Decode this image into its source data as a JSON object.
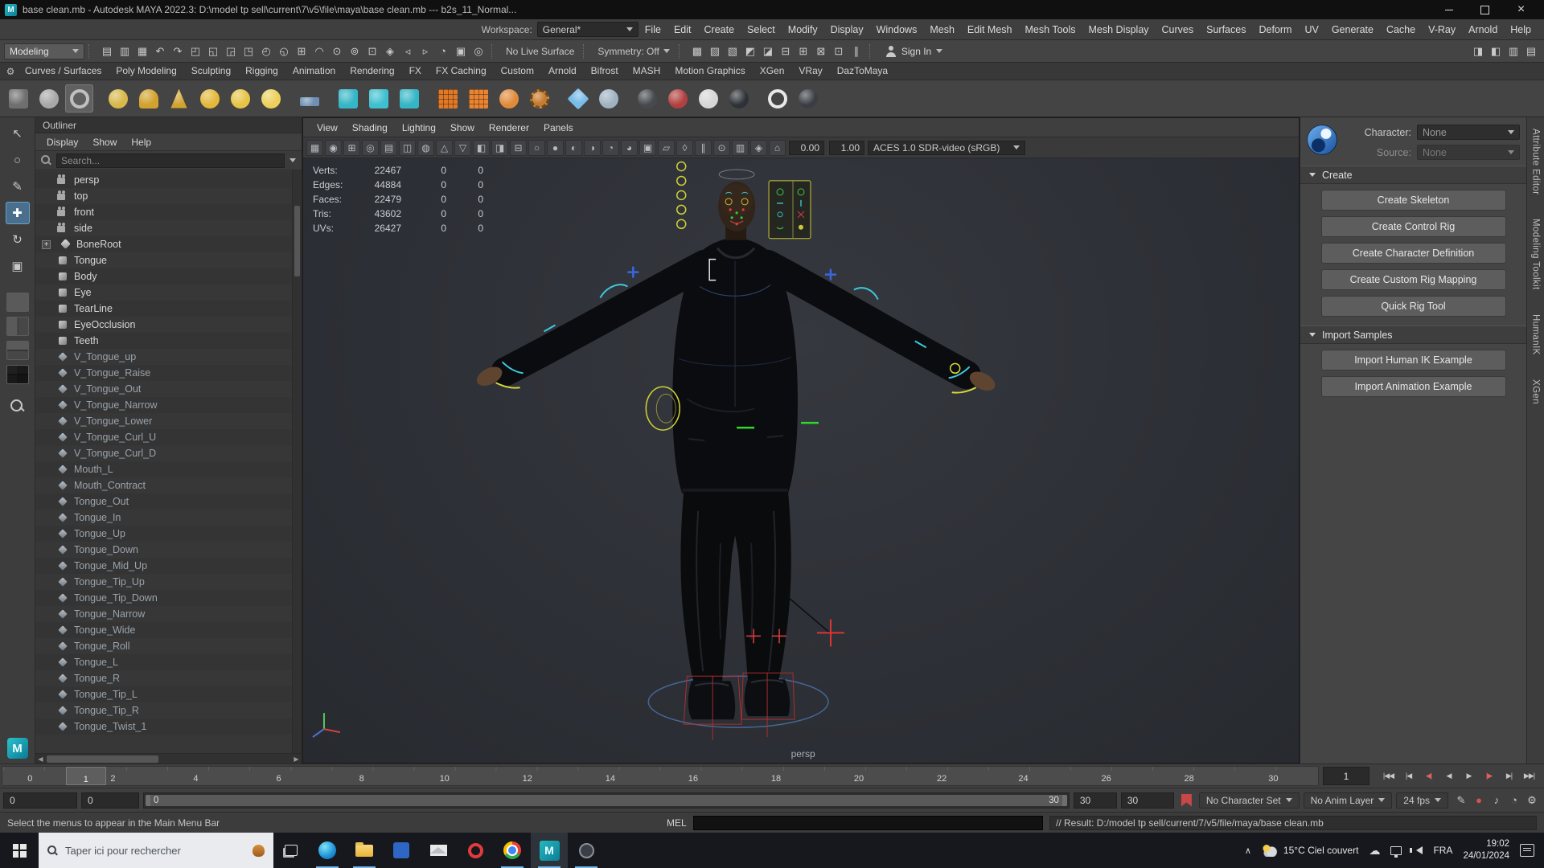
{
  "window": {
    "title": "base clean.mb - Autodesk MAYA 2022.3: D:\\model tp sell\\current\\7\\v5\\file\\maya\\base clean.mb  ---  b2s_11_Normal..."
  },
  "menu_bar": {
    "items": [
      "File",
      "Edit",
      "Create",
      "Select",
      "Modify",
      "Display",
      "Windows",
      "Mesh",
      "Edit Mesh",
      "Mesh Tools",
      "Mesh Display",
      "Curves",
      "Surfaces",
      "Deform",
      "UV",
      "Generate",
      "Cache",
      "V-Ray",
      "Arnold",
      "Help"
    ],
    "workspace_label": "Workspace:",
    "workspace_value": "General*"
  },
  "status_line": {
    "mode": "Modeling",
    "left_icons": [
      {
        "name": "new-scene-icon",
        "g": "▤"
      },
      {
        "name": "open-scene-icon",
        "g": "▥"
      },
      {
        "name": "save-scene-icon",
        "g": "▦"
      },
      {
        "name": "undo-icon",
        "g": "↶"
      },
      {
        "name": "redo-icon",
        "g": "↷"
      },
      {
        "name": "select-hierarchy-icon",
        "g": "◰"
      },
      {
        "name": "select-object-icon",
        "g": "◱"
      },
      {
        "name": "select-component-icon",
        "g": "◲"
      },
      {
        "name": "select-mask-vertex-icon",
        "g": "◳"
      },
      {
        "name": "select-mask-edge-icon",
        "g": "◴"
      },
      {
        "name": "select-mask-face-icon",
        "g": "◵"
      },
      {
        "name": "snap-to-grid-icon",
        "g": "⊞"
      },
      {
        "name": "snap-to-curve-icon",
        "g": "◠"
      },
      {
        "name": "snap-to-point-icon",
        "g": "⊙"
      },
      {
        "name": "snap-to-projected-center-icon",
        "g": "⊚"
      },
      {
        "name": "snap-to-view-plane-icon",
        "g": "⊡"
      },
      {
        "name": "make-live-icon",
        "g": "◈"
      },
      {
        "name": "input-connections-icon",
        "g": "◃"
      },
      {
        "name": "output-connections-icon",
        "g": "▹"
      },
      {
        "name": "construction-history-icon",
        "g": "◔"
      },
      {
        "name": "viewport-renderer-icon",
        "g": "▣"
      },
      {
        "name": "highlight-selection-icon",
        "g": "◎"
      }
    ],
    "no_live_surface": "No Live Surface",
    "symmetry": "Symmetry: Off",
    "right_icons": [
      {
        "name": "render-view-icon",
        "g": "▩"
      },
      {
        "name": "ipr-render-icon",
        "g": "▨"
      },
      {
        "name": "render-settings-icon",
        "g": "▧"
      },
      {
        "name": "hypershade-icon",
        "g": "◩"
      },
      {
        "name": "light-editor-icon",
        "g": "◪"
      },
      {
        "name": "toolkit-mesh-icon",
        "g": "⊟"
      },
      {
        "name": "toolkit-surface-icon",
        "g": "⊞"
      },
      {
        "name": "toolkit-uv-icon",
        "g": "⊠"
      },
      {
        "name": "toolkit-xgen-icon",
        "g": "⊡"
      },
      {
        "name": "pause-playback-icon",
        "g": "∥"
      }
    ],
    "sign_in": "Sign In",
    "panel_toggles": [
      {
        "name": "toggle-attribute-editor-icon",
        "g": "◨"
      },
      {
        "name": "toggle-tool-settings-icon",
        "g": "◧"
      },
      {
        "name": "toggle-channel-box-icon",
        "g": "▥"
      },
      {
        "name": "toggle-outliner-icon",
        "g": "▤"
      }
    ]
  },
  "shelf": {
    "tabs": [
      "Curves / Surfaces",
      "Poly Modeling",
      "Sculpting",
      "Rigging",
      "Animation",
      "Rendering",
      "FX",
      "FX Caching",
      "Custom",
      "Arnold",
      "Bifrost",
      "MASH",
      "Motion Graphics",
      "XGen",
      "VRay",
      "DazToMaya"
    ],
    "tools": [
      {
        "name": "shelf-tool-icon",
        "c": "#6f6f6f",
        "s": "shp-cube",
        "cls": ""
      },
      {
        "name": "shelf-tool-icon",
        "c": "#a8a8a8",
        "s": "shp-sphere",
        "cls": ""
      },
      {
        "name": "shelf-tool-icon",
        "c": "#c0c0c0",
        "s": "shp-ring",
        "cls": "active"
      },
      {
        "name": "shelf-tool-icon",
        "c": "#d8b84a",
        "s": "shp-sphere",
        "cls": "gap"
      },
      {
        "name": "shelf-tool-icon",
        "c": "#d2a22e",
        "s": "shp-dome",
        "cls": ""
      },
      {
        "name": "shelf-tool-icon",
        "c": "#d2a22e",
        "s": "shp-cone",
        "cls": ""
      },
      {
        "name": "shelf-tool-icon",
        "c": "#e2b83a",
        "s": "shp-sphere",
        "cls": ""
      },
      {
        "name": "shelf-tool-icon",
        "c": "#e6c446",
        "s": "shp-sphere",
        "cls": ""
      },
      {
        "name": "shelf-tool-icon",
        "c": "#ecd05a",
        "s": "shp-sphere",
        "cls": ""
      },
      {
        "name": "shelf-tool-icon",
        "c": "#6f90b2",
        "s": "shp-plane",
        "cls": "gap"
      },
      {
        "name": "shelf-tool-icon",
        "c": "#35b6c6",
        "s": "shp-cube",
        "cls": "gap"
      },
      {
        "name": "shelf-tool-icon",
        "c": "#3fc0d0",
        "s": "shp-cube",
        "cls": ""
      },
      {
        "name": "shelf-tool-icon",
        "c": "#35b6c6",
        "s": "shp-cube",
        "cls": ""
      },
      {
        "name": "shelf-tool-icon",
        "c": "#e07a28",
        "s": "shp-grid",
        "cls": "gap"
      },
      {
        "name": "shelf-tool-icon",
        "c": "#e88432",
        "s": "shp-grid",
        "cls": ""
      },
      {
        "name": "shelf-tool-icon",
        "c": "#e08a3a",
        "s": "shp-sphere",
        "cls": ""
      },
      {
        "name": "shelf-tool-icon",
        "c": "#c67c2e",
        "s": "shp-gear",
        "cls": ""
      },
      {
        "name": "shelf-tool-icon",
        "c": "#79bce8",
        "s": "shp-diamond",
        "cls": "gap"
      },
      {
        "name": "shelf-tool-icon",
        "c": "#9fb2c2",
        "s": "shp-sphere",
        "cls": ""
      },
      {
        "name": "shelf-tool-icon",
        "c": "#46494e",
        "s": "shp-sphere",
        "cls": "gap"
      },
      {
        "name": "shelf-tool-icon",
        "c": "#b24040",
        "s": "shp-sphere",
        "cls": ""
      },
      {
        "name": "shelf-tool-icon",
        "c": "#d6d6d6",
        "s": "shp-sphere",
        "cls": ""
      },
      {
        "name": "shelf-tool-icon",
        "c": "#2e3238",
        "s": "shp-sphere",
        "cls": ""
      },
      {
        "name": "shelf-tool-icon",
        "c": "#e8e8e8",
        "s": "shp-ring",
        "cls": "gap"
      },
      {
        "name": "shelf-tool-icon",
        "c": "#3a3e44",
        "s": "shp-sphere",
        "cls": ""
      }
    ]
  },
  "tool_column": {
    "tools": [
      {
        "name": "select-tool-icon",
        "g": "↖",
        "cls": ""
      },
      {
        "name": "lasso-tool-icon",
        "g": "○",
        "cls": ""
      },
      {
        "name": "paint-select-tool-icon",
        "g": "✎",
        "cls": ""
      },
      {
        "name": "move-tool-icon",
        "g": "✚",
        "cls": "active"
      },
      {
        "name": "rotate-tool-icon",
        "g": "↻",
        "cls": ""
      },
      {
        "name": "scale-tool-icon",
        "g": "▣",
        "cls": ""
      }
    ],
    "layouts": [
      {
        "name": "layout-single-pane-icon",
        "cls": "lay-l1"
      },
      {
        "name": "layout-two-pane-icon",
        "cls": "lay-l2"
      },
      {
        "name": "layout-stacked-pane-icon",
        "cls": "lay-l3"
      },
      {
        "name": "layout-four-pane-icon",
        "cls": "lay-l4"
      }
    ]
  },
  "outliner": {
    "title": "Outliner",
    "menus": [
      "Display",
      "Show",
      "Help"
    ],
    "search_placeholder": "Search...",
    "items": [
      {
        "label": "persp",
        "icon": "oi-cam",
        "cls": ""
      },
      {
        "label": "top",
        "icon": "oi-cam",
        "cls": ""
      },
      {
        "label": "front",
        "icon": "oi-cam",
        "cls": ""
      },
      {
        "label": "side",
        "icon": "oi-cam",
        "cls": ""
      },
      {
        "label": "BoneRoot",
        "icon": "oi-bone",
        "cls": "has-exp"
      },
      {
        "label": "Tongue",
        "icon": "oi-mesh",
        "cls": ""
      },
      {
        "label": "Body",
        "icon": "oi-mesh",
        "cls": ""
      },
      {
        "label": "Eye",
        "icon": "oi-mesh",
        "cls": ""
      },
      {
        "label": "TearLine",
        "icon": "oi-mesh",
        "cls": ""
      },
      {
        "label": "EyeOcclusion",
        "icon": "oi-mesh",
        "cls": ""
      },
      {
        "label": "Teeth",
        "icon": "oi-mesh",
        "cls": ""
      },
      {
        "label": "V_Tongue_up",
        "icon": "oi-blend",
        "cls": "dim"
      },
      {
        "label": "V_Tongue_Raise",
        "icon": "oi-blend",
        "cls": "dim"
      },
      {
        "label": "V_Tongue_Out",
        "icon": "oi-blend",
        "cls": "dim"
      },
      {
        "label": "V_Tongue_Narrow",
        "icon": "oi-blend",
        "cls": "dim"
      },
      {
        "label": "V_Tongue_Lower",
        "icon": "oi-blend",
        "cls": "dim"
      },
      {
        "label": "V_Tongue_Curl_U",
        "icon": "oi-blend",
        "cls": "dim"
      },
      {
        "label": "V_Tongue_Curl_D",
        "icon": "oi-blend",
        "cls": "dim"
      },
      {
        "label": "Mouth_L",
        "icon": "oi-blend",
        "cls": "dim"
      },
      {
        "label": "Mouth_Contract",
        "icon": "oi-blend",
        "cls": "dim"
      },
      {
        "label": "Tongue_Out",
        "icon": "oi-blend",
        "cls": "dim"
      },
      {
        "label": "Tongue_In",
        "icon": "oi-blend",
        "cls": "dim"
      },
      {
        "label": "Tongue_Up",
        "icon": "oi-blend",
        "cls": "dim"
      },
      {
        "label": "Tongue_Down",
        "icon": "oi-blend",
        "cls": "dim"
      },
      {
        "label": "Tongue_Mid_Up",
        "icon": "oi-blend",
        "cls": "dim"
      },
      {
        "label": "Tongue_Tip_Up",
        "icon": "oi-blend",
        "cls": "dim"
      },
      {
        "label": "Tongue_Tip_Down",
        "icon": "oi-blend",
        "cls": "dim"
      },
      {
        "label": "Tongue_Narrow",
        "icon": "oi-blend",
        "cls": "dim"
      },
      {
        "label": "Tongue_Wide",
        "icon": "oi-blend",
        "cls": "dim"
      },
      {
        "label": "Tongue_Roll",
        "icon": "oi-blend",
        "cls": "dim"
      },
      {
        "label": "Tongue_L",
        "icon": "oi-blend",
        "cls": "dim"
      },
      {
        "label": "Tongue_R",
        "icon": "oi-blend",
        "cls": "dim"
      },
      {
        "label": "Tongue_Tip_L",
        "icon": "oi-blend",
        "cls": "dim"
      },
      {
        "label": "Tongue_Tip_R",
        "icon": "oi-blend",
        "cls": "dim"
      },
      {
        "label": "Tongue_Twist_1",
        "icon": "oi-blend",
        "cls": "dim"
      }
    ]
  },
  "viewport": {
    "menus": [
      "View",
      "Shading",
      "Lighting",
      "Show",
      "Renderer",
      "Panels"
    ],
    "toolbar_icons": [
      {
        "name": "viewport-camera-icon",
        "g": "▦"
      },
      {
        "name": "viewport-select-icon",
        "g": "◉"
      },
      {
        "name": "viewport-grid-icon",
        "g": "⊞"
      },
      {
        "name": "viewport-gate-icon",
        "g": "◎"
      },
      {
        "name": "viewport-mask-icon",
        "g": "▤"
      },
      {
        "name": "viewport-fieldchart-icon",
        "g": "◫"
      },
      {
        "name": "viewport-gateview-icon",
        "g": "◍"
      },
      {
        "name": "viewport-wireframe-icon",
        "g": "△"
      },
      {
        "name": "viewport-shaded-icon",
        "g": "▽"
      },
      {
        "name": "viewport-textured-icon",
        "g": "◧"
      },
      {
        "name": "viewport-lights-icon",
        "g": "◨"
      },
      {
        "name": "viewport-shadows-icon",
        "g": "⊟"
      },
      {
        "name": "viewport-ao-icon",
        "g": "○"
      },
      {
        "name": "viewport-aa-icon",
        "g": "●"
      },
      {
        "name": "viewport-fog-icon",
        "g": "◐"
      },
      {
        "name": "viewport-dof-icon",
        "g": "◑"
      },
      {
        "name": "viewport-motionblur-icon",
        "g": "◔"
      },
      {
        "name": "viewport-isolate-icon",
        "g": "◕"
      },
      {
        "name": "viewport-xray-icon",
        "g": "▣"
      },
      {
        "name": "viewport-joints-icon",
        "g": "▱"
      },
      {
        "name": "viewport-curves-icon",
        "g": "◊"
      },
      {
        "name": "viewport-pause-icon",
        "g": "∥"
      },
      {
        "name": "viewport-snap-icon",
        "g": "⊙"
      },
      {
        "name": "viewport-plane-icon",
        "g": "▥"
      },
      {
        "name": "viewport-live-icon",
        "g": "◈"
      },
      {
        "name": "viewport-home-icon",
        "g": "⌂"
      }
    ],
    "exposure": "0.00",
    "gamma": "1.00",
    "colorspace": "ACES 1.0 SDR-video (sRGB)",
    "camera": "persp",
    "hud": [
      {
        "label": "Verts:",
        "v1": "22467",
        "v2": "0",
        "v3": "0"
      },
      {
        "label": "Edges:",
        "v1": "44884",
        "v2": "0",
        "v3": "0"
      },
      {
        "label": "Faces:",
        "v1": "22479",
        "v2": "0",
        "v3": "0"
      },
      {
        "label": "Tris:",
        "v1": "43602",
        "v2": "0",
        "v3": "0"
      },
      {
        "label": "UVs:",
        "v1": "26427",
        "v2": "0",
        "v3": "0"
      }
    ]
  },
  "humanik": {
    "character_label": "Character:",
    "character_value": "None",
    "source_label": "Source:",
    "source_value": "None",
    "create_title": "Create",
    "create_buttons": [
      "Create Skeleton",
      "Create Control Rig",
      "Create Character Definition",
      "Create Custom Rig Mapping",
      "Quick Rig Tool"
    ],
    "import_title": "Import Samples",
    "import_buttons": [
      "Import Human IK Example",
      "Import Animation Example"
    ]
  },
  "right_tabs": [
    "Attribute Editor",
    "Modeling Toolkit",
    "HumanIK",
    "XGen"
  ],
  "timeline": {
    "ticks": [
      {
        "t": "0",
        "x": "2.1%"
      },
      {
        "t": "2",
        "x": "8.4%"
      },
      {
        "t": "4",
        "x": "14.7%"
      },
      {
        "t": "6",
        "x": "21.0%"
      },
      {
        "t": "8",
        "x": "27.3%"
      },
      {
        "t": "10",
        "x": "33.6%"
      },
      {
        "t": "12",
        "x": "39.9%"
      },
      {
        "t": "14",
        "x": "46.2%"
      },
      {
        "t": "16",
        "x": "52.5%"
      },
      {
        "t": "18",
        "x": "58.8%"
      },
      {
        "t": "20",
        "x": "65.1%"
      },
      {
        "t": "22",
        "x": "71.4%"
      },
      {
        "t": "24",
        "x": "77.6%"
      },
      {
        "t": "26",
        "x": "83.9%"
      },
      {
        "t": "28",
        "x": "90.2%"
      },
      {
        "t": "30",
        "x": "96.6%"
      }
    ],
    "current_frame": "1",
    "current_x": "4.8%",
    "frame_field": "1",
    "playback": [
      {
        "name": "go-to-start-button",
        "g": "|◀◀",
        "cls": ""
      },
      {
        "name": "step-back-frame-button",
        "g": "|◀",
        "cls": ""
      },
      {
        "name": "step-back-key-button",
        "g": "◀|",
        "cls": "red"
      },
      {
        "name": "play-backwards-button",
        "g": "◀",
        "cls": ""
      },
      {
        "name": "play-forwards-button",
        "g": "▶",
        "cls": ""
      },
      {
        "name": "step-forward-key-button",
        "g": "|▶",
        "cls": "red"
      },
      {
        "name": "step-forward-frame-button",
        "g": "▶|",
        "cls": ""
      },
      {
        "name": "go-to-end-button",
        "g": "▶▶|",
        "cls": ""
      }
    ]
  },
  "range_slider": {
    "anim_start": "0",
    "playback_start": "0",
    "bar_left": "0",
    "bar_right": "30",
    "playback_end": "30",
    "anim_end": "30",
    "char_set": "No Character Set",
    "anim_layer": "No Anim Layer",
    "fps": "24 fps",
    "icons": [
      {
        "name": "playblast-icon",
        "g": "✎",
        "cls": ""
      },
      {
        "name": "auto-key-icon",
        "g": "●",
        "cls": "red"
      },
      {
        "name": "mute-audio-icon",
        "g": "♪",
        "cls": ""
      },
      {
        "name": "playback-speed-icon",
        "g": "◔",
        "cls": ""
      },
      {
        "name": "animation-preferences-icon",
        "g": "⚙",
        "cls": ""
      }
    ]
  },
  "bottom_bar": {
    "help_text": "Select the menus to appear in the Main Menu Bar",
    "mel_label": "MEL",
    "result": "// Result: D:/model tp sell/current/7/v5/file/maya/base clean.mb"
  },
  "taskbar": {
    "search_placeholder": "Taper ici pour rechercher",
    "apps": [
      {
        "name": "taskbar-app-edge",
        "kind": "app-edge",
        "cls": "open"
      },
      {
        "name": "taskbar-app-explorer",
        "kind": "app-folder",
        "cls": "open"
      },
      {
        "name": "taskbar-app-photos",
        "kind": "app-blue",
        "cls": ""
      },
      {
        "name": "taskbar-app-mail",
        "kind": "app-mail",
        "cls": ""
      },
      {
        "name": "taskbar-app-opera",
        "kind": "app-opera",
        "cls": ""
      },
      {
        "name": "taskbar-app-chrome",
        "kind": "app-chrome",
        "cls": "open"
      },
      {
        "name": "taskbar-app-maya",
        "kind": "app-maya",
        "cls": "active open"
      },
      {
        "name": "taskbar-app-recorder",
        "kind": "app-circle",
        "cls": "open"
      }
    ],
    "weather_text": "15°C Ciel couvert",
    "language": "FRA",
    "time": "19:02",
    "date": "24/01/2024"
  }
}
